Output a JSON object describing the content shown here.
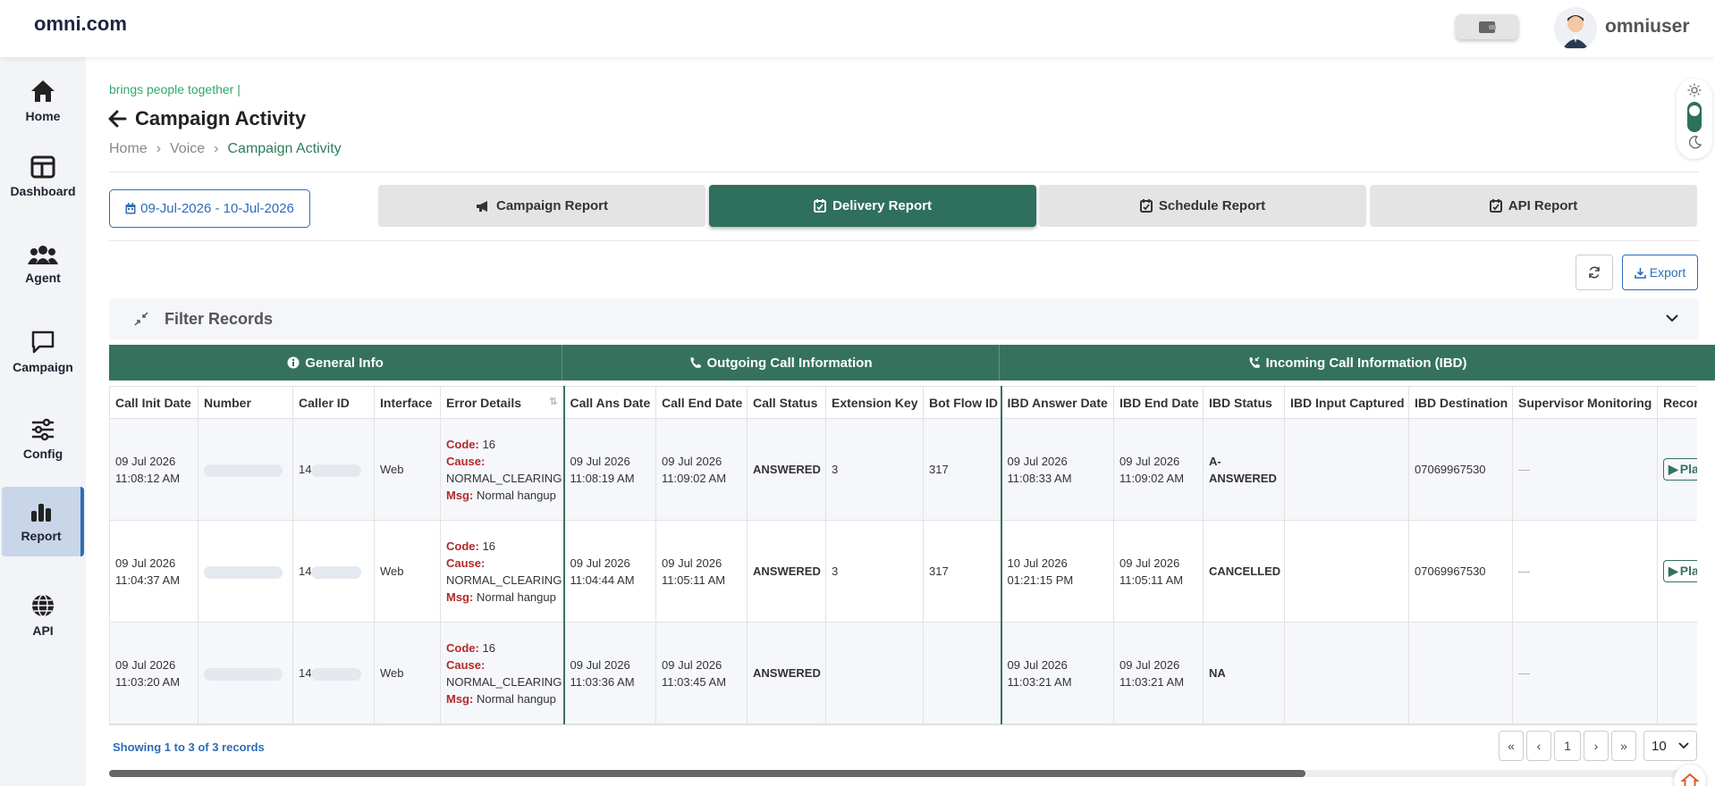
{
  "header": {
    "brand": "omni.com",
    "username": "omniuser"
  },
  "sidebar": {
    "items": [
      {
        "label": "Home",
        "icon": "home-icon"
      },
      {
        "label": "Dashboard",
        "icon": "dashboard-icon"
      },
      {
        "label": "Agent",
        "icon": "users-icon"
      },
      {
        "label": "Campaign",
        "icon": "chat-icon"
      },
      {
        "label": "Config",
        "icon": "sliders-icon"
      },
      {
        "label": "Report",
        "icon": "bar-chart-icon",
        "active": true
      },
      {
        "label": "API",
        "icon": "globe-icon"
      }
    ]
  },
  "page": {
    "tagline": "brings people together",
    "title": "Campaign Activity",
    "breadcrumb": [
      "Home",
      "Voice",
      "Campaign Activity"
    ]
  },
  "toolbar": {
    "date_range": "09-Jul-2026 - 10-Jul-2026",
    "tabs": [
      "Campaign Report",
      "Delivery Report",
      "Schedule Report",
      "API Report"
    ],
    "active_tab": "Delivery Report",
    "export_label": "Export"
  },
  "filter": {
    "title": "Filter Records"
  },
  "table": {
    "groups": [
      "General Info",
      "Outgoing Call Information",
      "Incoming Call Information (IBD)"
    ],
    "columns": [
      "Call Init Date",
      "Number",
      "Caller ID",
      "Interface",
      "Error Details",
      "Call Ans Date",
      "Call End Date",
      "Call Status",
      "Extension Key",
      "Bot Flow ID",
      "IBD Answer Date",
      "IBD End Date",
      "IBD Status",
      "IBD Input Captured",
      "IBD Destination",
      "Supervisor Monitoring",
      "Recording"
    ],
    "error_labels": {
      "code": "Code:",
      "cause": "Cause:",
      "msg": "Msg:"
    },
    "play_label": "Play",
    "rows": [
      {
        "init_date": "09 Jul 2026",
        "init_time": "11:08:12 AM",
        "number": "",
        "caller_id": "14",
        "interface": "Web",
        "code": "16",
        "cause": "NORMAL_CLEARING",
        "msg": "Normal hangup",
        "ans_date": "09 Jul 2026",
        "ans_time": "11:08:19 AM",
        "end_date": "09 Jul 2026",
        "end_time": "11:09:02 AM",
        "status": "ANSWERED",
        "ext_key": "3",
        "bot_flow": "317",
        "ibd_ans_date": "09 Jul 2026",
        "ibd_ans_time": "11:08:33 AM",
        "ibd_end_date": "09 Jul 2026",
        "ibd_end_time": "11:09:02 AM",
        "ibd_status": "A-ANSWERED",
        "ibd_input": "",
        "ibd_dest": "07069967530",
        "supervisor": "—"
      },
      {
        "init_date": "09 Jul 2026",
        "init_time": "11:04:37 AM",
        "number": "",
        "caller_id": "14",
        "interface": "Web",
        "code": "16",
        "cause": "NORMAL_CLEARING",
        "msg": "Normal hangup",
        "ans_date": "09 Jul 2026",
        "ans_time": "11:04:44 AM",
        "end_date": "09 Jul 2026",
        "end_time": "11:05:11 AM",
        "status": "ANSWERED",
        "ext_key": "3",
        "bot_flow": "317",
        "ibd_ans_date": "10 Jul 2026",
        "ibd_ans_time": "01:21:15 PM",
        "ibd_end_date": "09 Jul 2026",
        "ibd_end_time": "11:05:11 AM",
        "ibd_status": "CANCELLED",
        "ibd_input": "",
        "ibd_dest": "07069967530",
        "supervisor": "—"
      },
      {
        "init_date": "09 Jul 2026",
        "init_time": "11:03:20 AM",
        "number": "",
        "caller_id": "14",
        "interface": "Web",
        "code": "16",
        "cause": "NORMAL_CLEARING",
        "msg": "Normal hangup",
        "ans_date": "09 Jul 2026",
        "ans_time": "11:03:36 AM",
        "end_date": "09 Jul 2026",
        "end_time": "11:03:45 AM",
        "status": "ANSWERED",
        "ext_key": "",
        "bot_flow": "",
        "ibd_ans_date": "09 Jul 2026",
        "ibd_ans_time": "11:03:21 AM",
        "ibd_end_date": "09 Jul 2026",
        "ibd_end_time": "11:03:21 AM",
        "ibd_status": "NA",
        "ibd_input": "",
        "ibd_dest": "",
        "supervisor": "—"
      }
    ]
  },
  "pagination": {
    "showing": "Showing 1 to 3 of 3 records",
    "first": "«",
    "prev": "‹",
    "page": "1",
    "next": "›",
    "last": "»",
    "page_size": "10"
  },
  "colors": {
    "primary": "#35725e",
    "link": "#2e6cb8",
    "error_label": "#b02a2a",
    "tagline": "#2eaa6b"
  }
}
